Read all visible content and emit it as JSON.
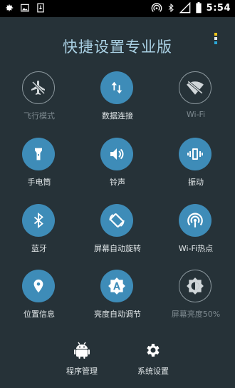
{
  "statusbar": {
    "time": "5:54"
  },
  "title": "快捷设置专业版",
  "colors": {
    "background": "#263238",
    "accent": "#3E8CB8",
    "title": "#A9D0E3",
    "disabled_text": "#7E8A90"
  },
  "tiles": [
    {
      "label": "飞行模式",
      "icon": "airplane-off-icon",
      "active": false
    },
    {
      "label": "数据连接",
      "icon": "data-arrows-icon",
      "active": true
    },
    {
      "label": "Wi-Fi",
      "icon": "wifi-off-icon",
      "active": false
    },
    {
      "label": "手电筒",
      "icon": "flashlight-icon",
      "active": true
    },
    {
      "label": "铃声",
      "icon": "volume-icon",
      "active": true
    },
    {
      "label": "振动",
      "icon": "vibrate-icon",
      "active": true
    },
    {
      "label": "蓝牙",
      "icon": "bluetooth-icon",
      "active": true
    },
    {
      "label": "屏幕自动旋转",
      "icon": "rotate-icon",
      "active": true
    },
    {
      "label": "Wi-Fi热点",
      "icon": "hotspot-icon",
      "active": true
    },
    {
      "label": "位置信息",
      "icon": "location-icon",
      "active": true
    },
    {
      "label": "亮度自动调节",
      "icon": "auto-brightness-icon",
      "active": true
    },
    {
      "label": "屏幕亮度50%",
      "icon": "brightness-half-icon",
      "active": false
    }
  ],
  "bottom": {
    "apps": {
      "label": "程序管理",
      "icon": "android-icon"
    },
    "settings": {
      "label": "系统设置",
      "icon": "gear-icon"
    }
  }
}
